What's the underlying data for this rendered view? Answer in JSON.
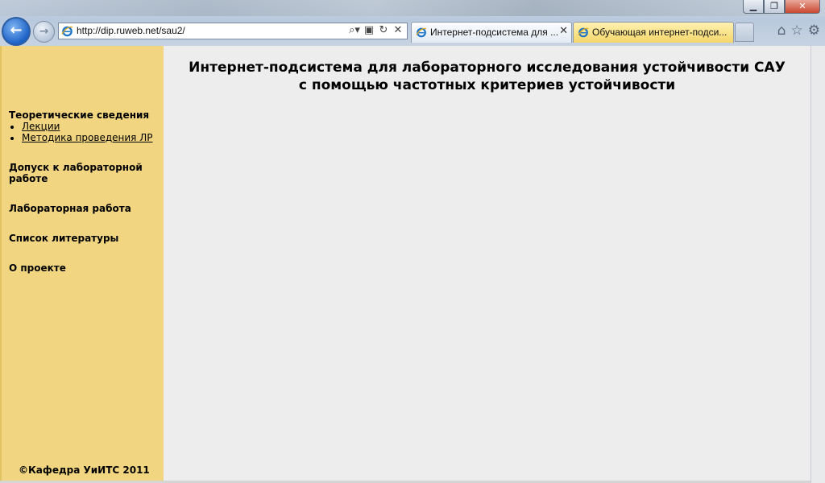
{
  "window": {
    "min_label": "▁",
    "restore_label": "❐",
    "close_label": "✕"
  },
  "browser": {
    "address_url": "http://dip.ruweb.net/sau2/",
    "tabs": [
      {
        "title": "Интернет-подсистема для ..."
      },
      {
        "title": "Обучающая интернет-подси..."
      }
    ],
    "tab_close_label": "✕",
    "icons": {
      "back": "←",
      "forward": "→",
      "search": "⌕▾",
      "compat": "▣",
      "refresh": "↻",
      "stop": "✕",
      "home": "⌂",
      "favorites": "☆",
      "tools": "⚙"
    }
  },
  "page": {
    "heading_line1": "Интернет-подсистема для лабораторного исследования устойчивости САУ",
    "heading_line2": "с помощью частотных критериев устойчивости",
    "sidebar": {
      "section_theory": "Теоретические сведения",
      "theory_links": [
        "Лекции",
        "Методика проведения ЛР"
      ],
      "admission_line1": "Допуск к лабораторной",
      "admission_line2": "работе",
      "lab_work": "Лабораторная работа",
      "literature": "Список литературы",
      "about": "О проекте",
      "footer": "©Кафедра УиИТС 2011"
    }
  },
  "colors": {
    "sidebar_bg": "#f1d580",
    "content_bg": "#ededed",
    "tab_active_bg": "#f5d66a"
  }
}
